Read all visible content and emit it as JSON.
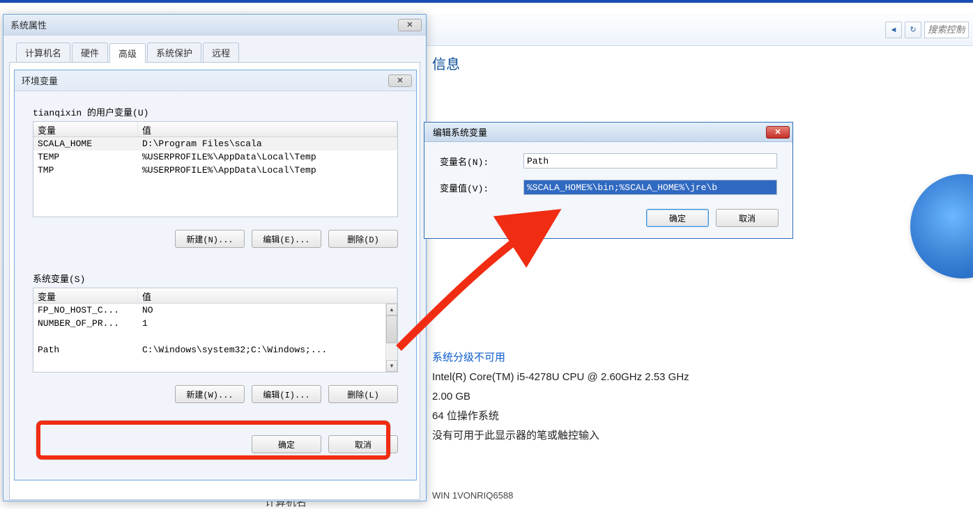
{
  "topstrip": true,
  "bg": {
    "big_title": "信息",
    "rating_link": "系统分级不可用",
    "cpu": "Intel(R) Core(TM) i5-4278U CPU @ 2.60GHz   2.53 GHz",
    "ram": "2.00 GB",
    "ostype": "64 位操作系统",
    "pen": "没有可用于此显示器的笔或触控输入",
    "search_placeholder": "搜索控制",
    "footer_label": "计算机名",
    "footer_comp": "WIN 1VONRIQ6588"
  },
  "sysprops": {
    "title": "系统属性",
    "tabs": [
      "计算机名",
      "硬件",
      "高级",
      "系统保护",
      "远程"
    ],
    "active_tab": 2
  },
  "envdlg": {
    "title": "环境变量",
    "user_label": "tianqixin 的用户变量(U)",
    "sys_label": "系统变量(S)",
    "col_var": "变量",
    "col_val": "值",
    "user_vars": [
      {
        "name": "SCALA_HOME",
        "value": "D:\\Program Files\\scala"
      },
      {
        "name": "TEMP",
        "value": "%USERPROFILE%\\AppData\\Local\\Temp"
      },
      {
        "name": "TMP",
        "value": "%USERPROFILE%\\AppData\\Local\\Temp"
      }
    ],
    "sys_vars": [
      {
        "name": "FP_NO_HOST_C...",
        "value": "NO"
      },
      {
        "name": "NUMBER_OF_PR...",
        "value": "1"
      },
      {
        "name": "",
        "value": ""
      },
      {
        "name": "Path",
        "value": "C:\\Windows\\system32;C:\\Windows;..."
      }
    ],
    "btn_new_u": "新建(N)...",
    "btn_edit_u": "编辑(E)...",
    "btn_del_u": "删除(D)",
    "btn_new_s": "新建(W)...",
    "btn_edit_s": "编辑(I)...",
    "btn_del_s": "删除(L)",
    "btn_ok": "确定",
    "btn_cancel": "取消"
  },
  "editdlg": {
    "title": "编辑系统变量",
    "name_label": "变量名(N):",
    "value_label": "变量值(V):",
    "name_value": "Path",
    "value_value": "%SCALA_HOME%\\bin;%SCALA_HOME%\\jre\\b",
    "btn_ok": "确定",
    "btn_cancel": "取消"
  }
}
